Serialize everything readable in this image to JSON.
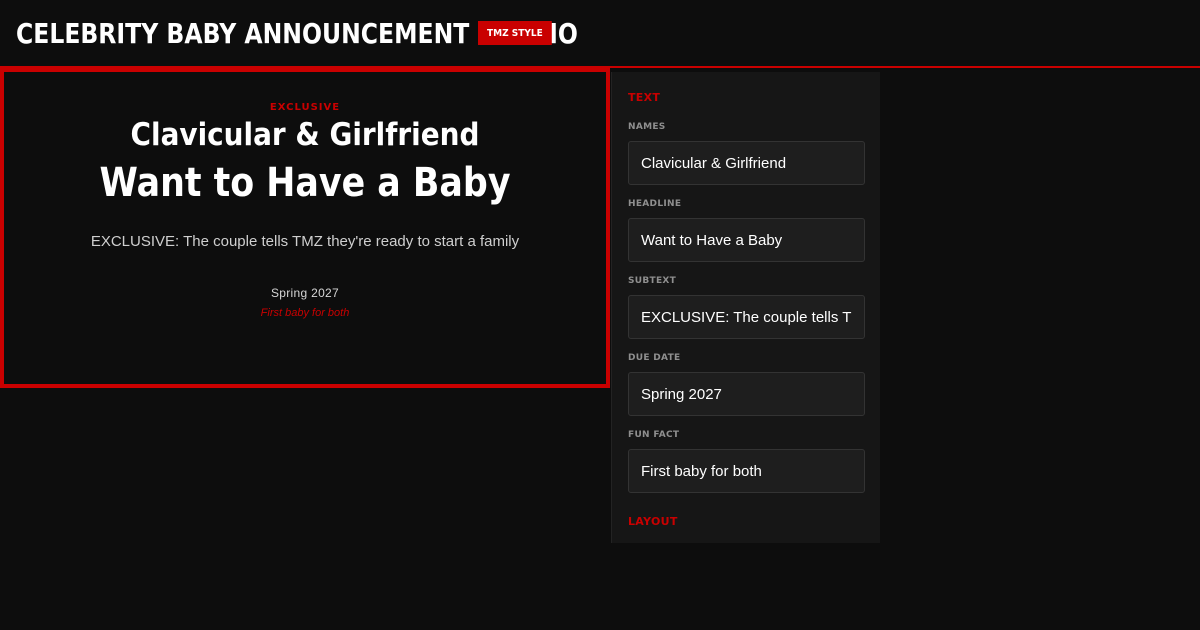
{
  "header": {
    "title": "CELEBRITY BABY ANNOUNCEMENT STUDIO",
    "badge": "TMZ STYLE"
  },
  "preview": {
    "kicker": "EXCLUSIVE",
    "names": "Clavicular & Girlfriend",
    "headline": "Want to Have a Baby",
    "subtext": "EXCLUSIVE: The couple tells TMZ they're ready to start a family",
    "due_date": "Spring 2027",
    "fun_fact": "First baby for both"
  },
  "panel": {
    "text_section_title": "TEXT",
    "layout_section_title": "LAYOUT",
    "fields": {
      "names": {
        "label": "NAMES",
        "value": "Clavicular & Girlfriend"
      },
      "headline": {
        "label": "HEADLINE",
        "value": "Want to Have a Baby"
      },
      "subtext": {
        "label": "SUBTEXT",
        "value": "EXCLUSIVE: The couple tells TMZ they're ready to start a family"
      },
      "due_date": {
        "label": "DUE DATE",
        "value": "Spring 2027"
      },
      "fun_fact": {
        "label": "FUN FACT",
        "value": "First baby for both"
      }
    }
  },
  "colors": {
    "accent": "#c90000",
    "background": "#0d0d0d",
    "panel": "#161616",
    "input": "#1e1e1e"
  }
}
